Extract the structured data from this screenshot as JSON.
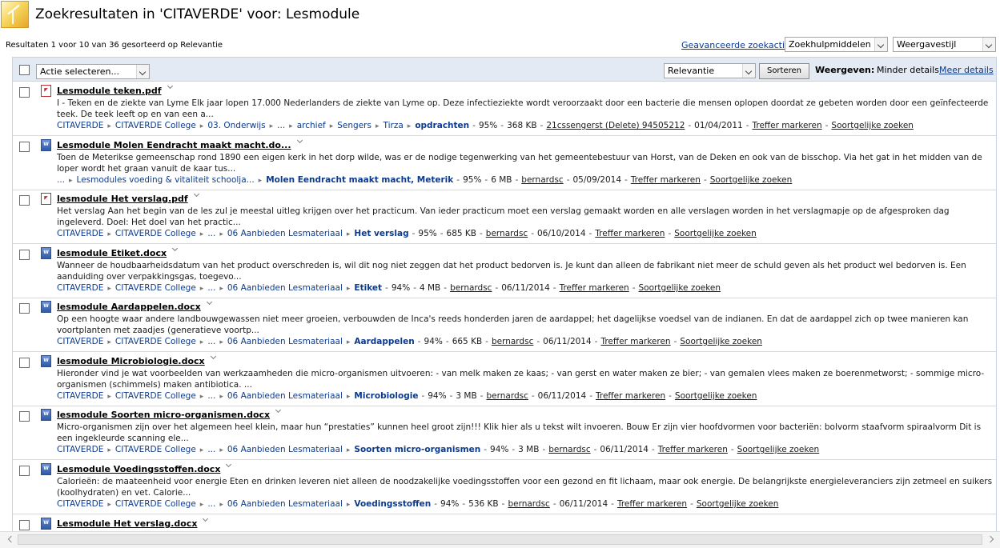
{
  "header": {
    "title": "Zoekresultaten in 'CITAVERDE' voor: Lesmodule",
    "results_info": "Resultaten 1 voor 10 van 36 gesorteerd op Relevantie",
    "advanced_search": "Geavanceerde zoekactie",
    "search_tools_select": "Zoekhulpmiddelen",
    "view_style_select": "Weergavestijl"
  },
  "toolbar": {
    "action_select": "Actie selecteren...",
    "sort_select": "Relevantie",
    "sort_button": "Sorteren",
    "show_label": "Weergeven:",
    "less_details": "Minder details",
    "more_details": "Meer details"
  },
  "results": [
    {
      "title": "Lesmodule teken.pdf",
      "icon": "pdf-icon",
      "description": "I - Teken en de ziekte van Lyme Elk jaar lopen 17.000 Nederlanders de ziekte van Lyme op. Deze infectieziekte wordt veroorzaakt door een bacterie die mensen oplopen doordat ze gebeten worden door een geïnfecteerde teek. De teek leeft op en van een a...",
      "crumbs": [
        "CITAVERDE",
        "CITAVERDE College",
        "03. Onderwijs",
        "...",
        "archief",
        "Sengers",
        "Tirza"
      ],
      "crumb_last": "opdrachten",
      "relevance": "95%",
      "size": "368 KB",
      "author": "21cssengerst (Delete) 94505212",
      "date": "01/04/2011",
      "mark_hits": "Treffer markeren",
      "similar": "Soortgelijke zoeken"
    },
    {
      "title": "Lesmodule Molen Eendracht maakt macht.do...",
      "icon": "docx-icon",
      "description": "Toen de Meterikse gemeenschap rond 1890 een eigen kerk in het dorp wilde, was er de nodige tegenwerking van het gemeentebestuur van Horst, van de Deken en ook van de bisschop. Via het gat in het midden van de loper wordt het graan vanuit de kaar tus...",
      "crumbs": [
        "...",
        "Lesmodules voeding & vitaliteit schoolja..."
      ],
      "crumb_last": "Molen Eendracht maakt macht, Meterik",
      "relevance": "95%",
      "size": "6 MB",
      "author": "bernardsc",
      "date": "05/09/2014",
      "mark_hits": "Treffer markeren",
      "similar": "Soortgelijke zoeken"
    },
    {
      "title": "lesmodule Het verslag.pdf",
      "icon": "pdf-icon",
      "description": "Het verslag Aan het begin van de les zul je meestal uitleg krijgen over het practicum. Van ieder practicum moet een verslag gemaakt worden en alle verslagen worden in het verslagmapje op de afgesproken dag ingeleverd. Doel: Het doel van het practic...",
      "crumbs": [
        "CITAVERDE",
        "CITAVERDE College",
        "...",
        "06 Aanbieden Lesmateriaal"
      ],
      "crumb_last": "Het verslag",
      "relevance": "95%",
      "size": "685 KB",
      "author": "bernardsc",
      "date": "06/10/2014",
      "mark_hits": "Treffer markeren",
      "similar": "Soortgelijke zoeken"
    },
    {
      "title": "lesmodule Etiket.docx",
      "icon": "docx-icon",
      "description": "Wanneer de houdbaarheidsdatum van het product overschreden is, wil dit nog niet zeggen dat het product bedorven is. Je kunt dan alleen de fabrikant niet meer de schuld geven als het product wel bedorven is. Een aanduiding over verpakkingsgas, toegevo...",
      "crumbs": [
        "CITAVERDE",
        "CITAVERDE College",
        "...",
        "06 Aanbieden Lesmateriaal"
      ],
      "crumb_last": "Etiket",
      "relevance": "94%",
      "size": "4 MB",
      "author": "bernardsc",
      "date": "06/11/2014",
      "mark_hits": "Treffer markeren",
      "similar": "Soortgelijke zoeken"
    },
    {
      "title": "lesmodule Aardappelen.docx",
      "icon": "docx-icon",
      "description": "Op een hoogte waar andere landbouwgewassen niet meer groeien, verbouwden de Inca's reeds honderden jaren de aardappel; het dagelijkse voedsel van de indianen. En dat de aardappel zich op twee manieren kan voortplanten met zaadjes (generatieve voortp...",
      "crumbs": [
        "CITAVERDE",
        "CITAVERDE College",
        "...",
        "06 Aanbieden Lesmateriaal"
      ],
      "crumb_last": "Aardappelen",
      "relevance": "94%",
      "size": "665 KB",
      "author": "bernardsc",
      "date": "06/11/2014",
      "mark_hits": "Treffer markeren",
      "similar": "Soortgelijke zoeken"
    },
    {
      "title": "lesmodule Microbiologie.docx",
      "icon": "docx-icon",
      "description": "Hieronder vind je wat voorbeelden van werkzaamheden die micro-organismen uitvoeren: - van melk maken ze kaas; - van gerst en water maken ze bier; - van gemalen vlees maken ze boerenmetworst; - sommige micro-organismen (schimmels) maken antibiotica. ...",
      "crumbs": [
        "CITAVERDE",
        "CITAVERDE College",
        "...",
        "06 Aanbieden Lesmateriaal"
      ],
      "crumb_last": "Microbiologie",
      "relevance": "94%",
      "size": "3 MB",
      "author": "bernardsc",
      "date": "06/11/2014",
      "mark_hits": "Treffer markeren",
      "similar": "Soortgelijke zoeken"
    },
    {
      "title": "lesmodule Soorten micro-organismen.docx",
      "icon": "docx-icon",
      "description": "Micro-organismen zijn over het algemeen heel klein, maar hun “prestaties” kunnen heel groot zijn!!! Klik hier als u tekst wilt invoeren. Bouw Er zijn vier hoofdvormen voor bacteriën: bolvorm staafvorm spiraalvorm Dit is een ingekleurde scanning ele...",
      "crumbs": [
        "CITAVERDE",
        "CITAVERDE College",
        "...",
        "06 Aanbieden Lesmateriaal"
      ],
      "crumb_last": "Soorten micro-organismen",
      "relevance": "94%",
      "size": "3 MB",
      "author": "bernardsc",
      "date": "06/11/2014",
      "mark_hits": "Treffer markeren",
      "similar": "Soortgelijke zoeken"
    },
    {
      "title": "Lesmodule Voedingsstoffen.docx",
      "icon": "docx-icon",
      "description": "Calorieën: de maateenheid voor energie Eten en drinken leveren niet alleen de noodzakelijke voedingsstoffen voor een gezond en fit lichaam, maar ook energie. De belangrijkste energieleveranciers zijn zetmeel en suikers (koolhydraten) en vet. Calorie...",
      "crumbs": [
        "CITAVERDE",
        "CITAVERDE College",
        "...",
        "06 Aanbieden Lesmateriaal"
      ],
      "crumb_last": "Voedingsstoffen",
      "relevance": "94%",
      "size": "536 KB",
      "author": "bernardsc",
      "date": "06/11/2014",
      "mark_hits": "Treffer markeren",
      "similar": "Soortgelijke zoeken"
    },
    {
      "title": "Lesmodule Het verslag.docx",
      "icon": "docx-icon"
    }
  ]
}
